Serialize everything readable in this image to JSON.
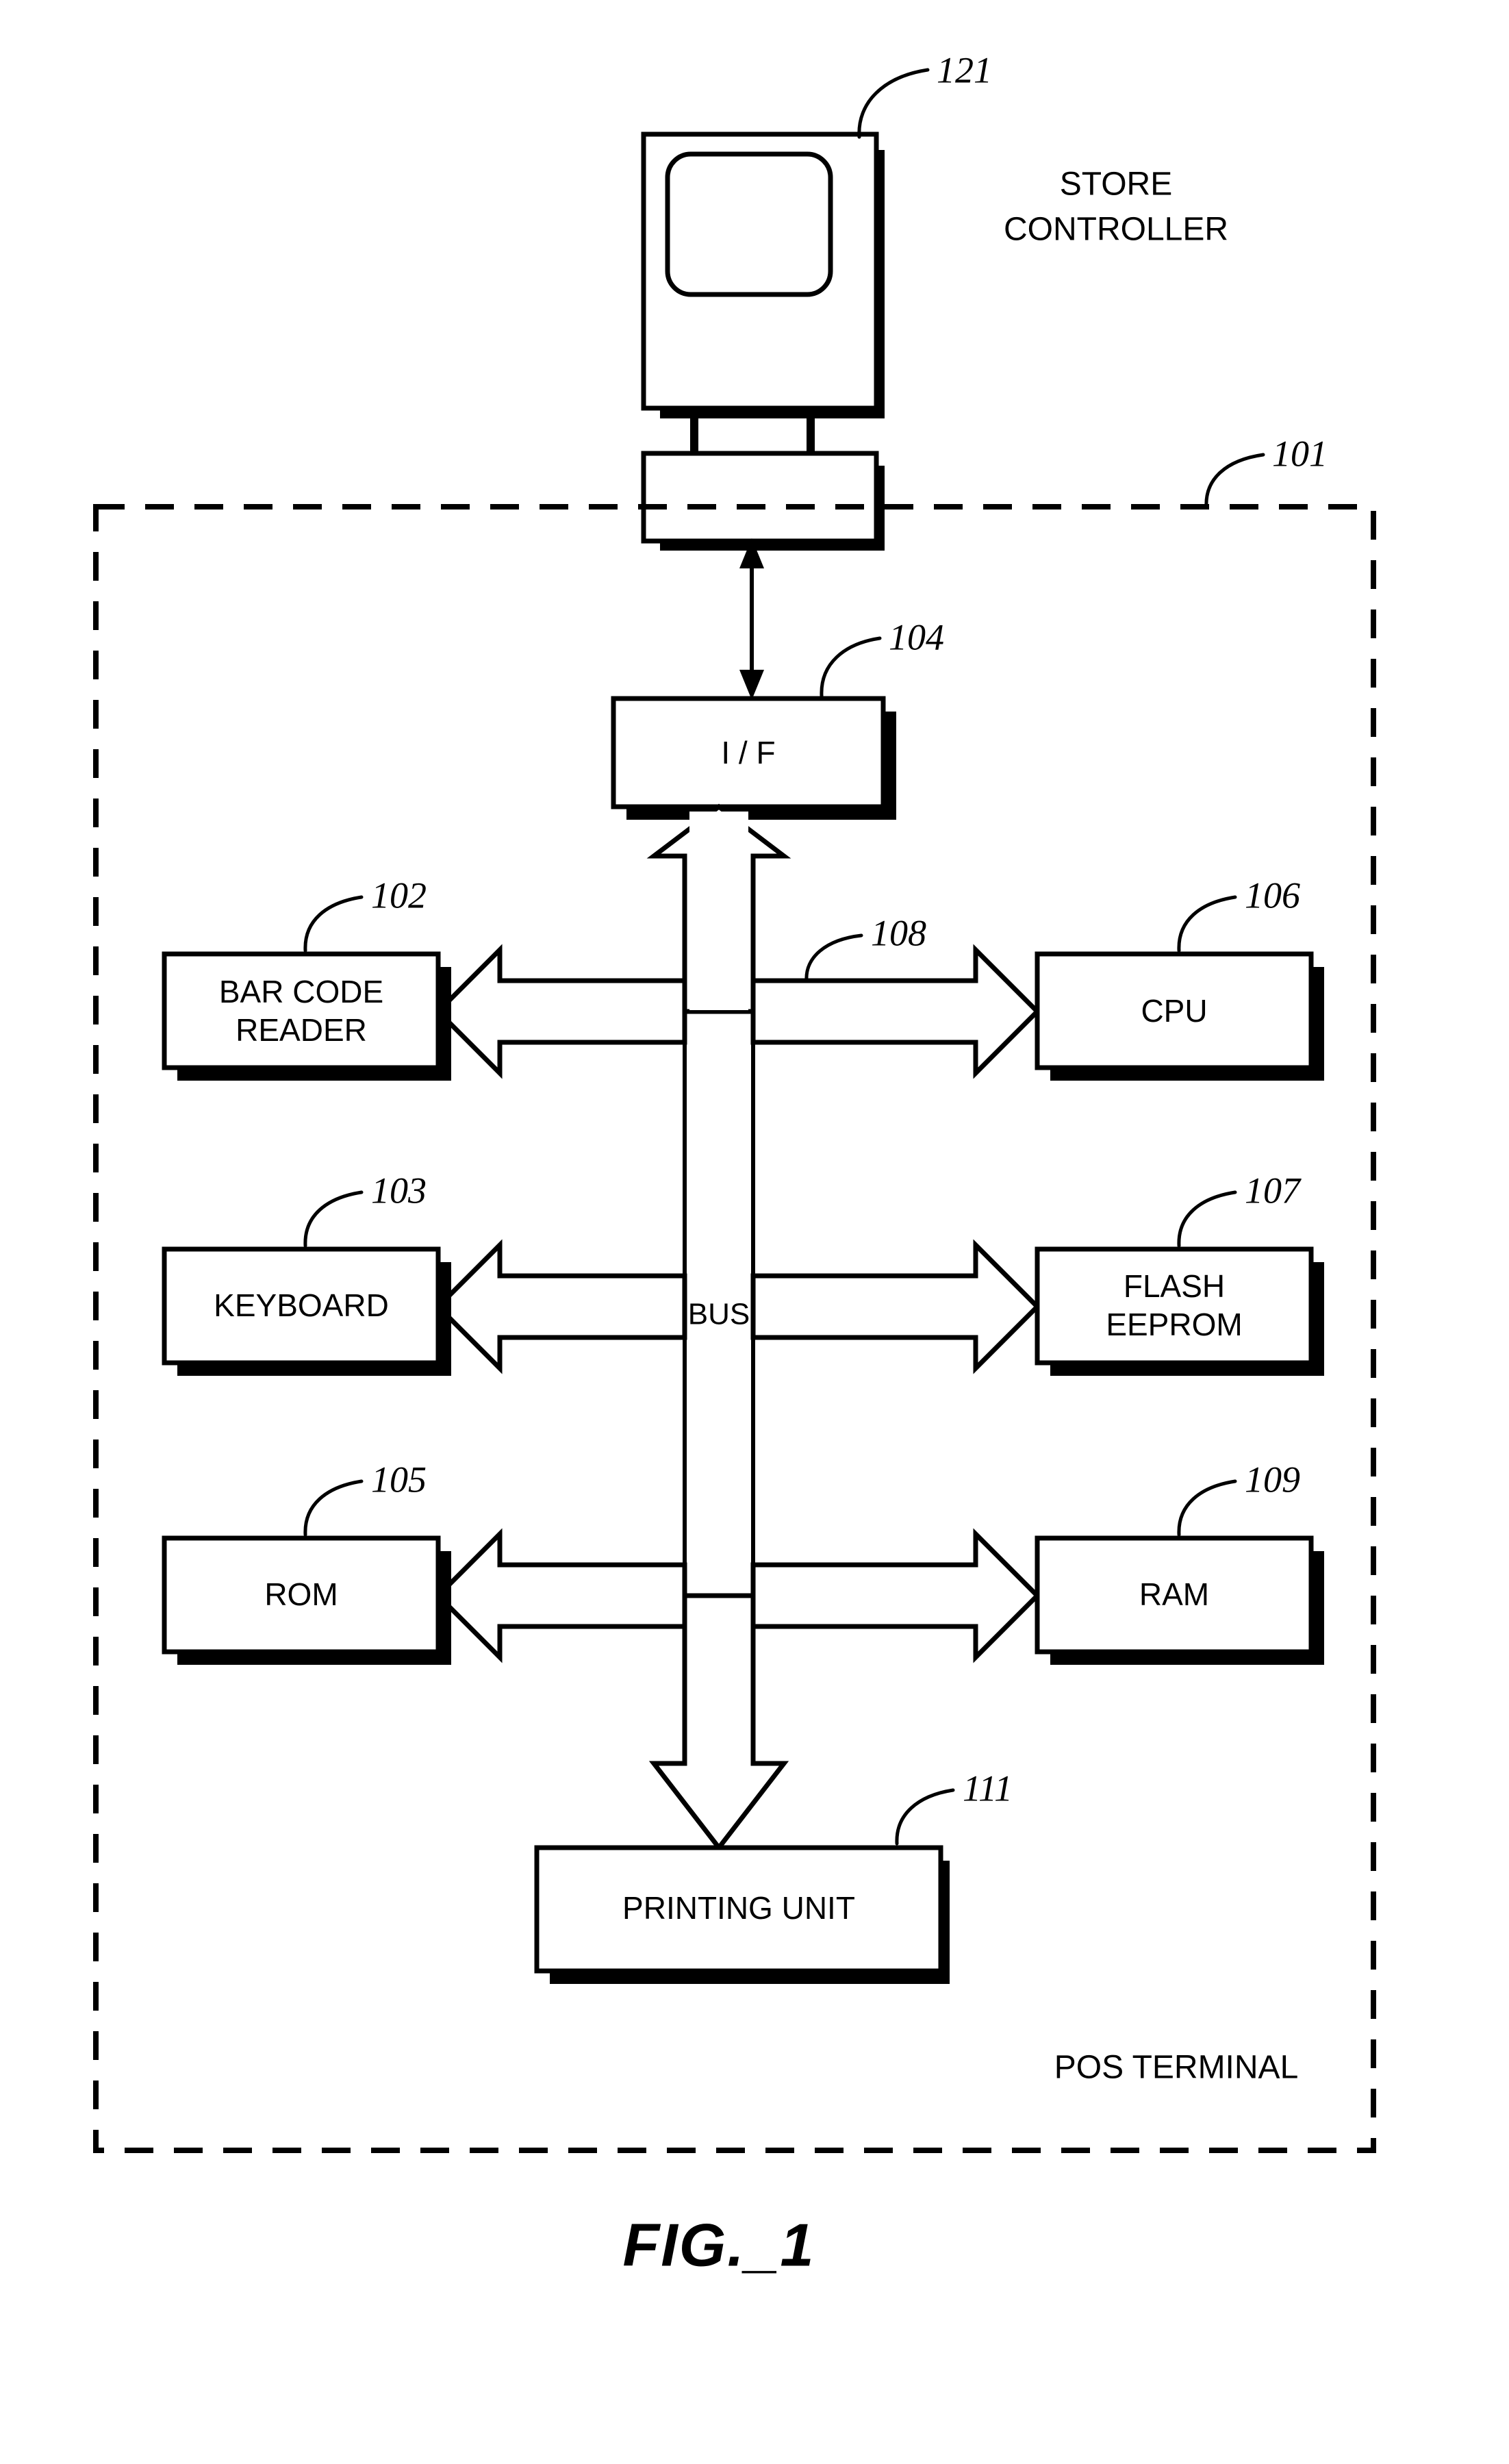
{
  "figure": {
    "caption": "FIG._1",
    "title_block": "STORE CONTROLLER",
    "enclosure_label": "POS TERMINAL",
    "bus_label": "BUS",
    "enclosure_ref": "101",
    "line_color": "#000000",
    "background_color": "#ffffff"
  },
  "external": {
    "store_controller": {
      "label": "STORE CONTROLLER",
      "ref": "121",
      "icon": "computer-monitor-icon"
    }
  },
  "blocks": [
    {
      "id": "if",
      "label": "I / F",
      "ref": "104"
    },
    {
      "id": "bar_code",
      "label": "BAR CODE READER",
      "label_line1": "BAR CODE",
      "label_line2": "READER",
      "ref": "102"
    },
    {
      "id": "keyboard",
      "label": "KEYBOARD",
      "ref": "103"
    },
    {
      "id": "rom",
      "label": "ROM",
      "ref": "105"
    },
    {
      "id": "cpu",
      "label": "CPU",
      "ref": "106"
    },
    {
      "id": "flash_eeprom",
      "label": "FLASH EEPROM",
      "label_line1": "FLASH",
      "label_line2": "EEPROM",
      "ref": "107"
    },
    {
      "id": "ram",
      "label": "RAM",
      "ref": "109"
    },
    {
      "id": "printing_unit",
      "label": "PRINTING UNIT",
      "ref": "111"
    }
  ],
  "bus": {
    "label": "BUS",
    "ref": "108"
  },
  "connections": [
    {
      "from": "store_controller",
      "to": "if",
      "style": "thin-double-arrow"
    },
    {
      "from": "bus",
      "to": "if",
      "style": "hollow-arrow"
    },
    {
      "from": "bus",
      "to": "bar_code",
      "style": "hollow-arrow"
    },
    {
      "from": "bus",
      "to": "keyboard",
      "style": "hollow-arrow"
    },
    {
      "from": "bus",
      "to": "rom",
      "style": "hollow-arrow"
    },
    {
      "from": "bus",
      "to": "cpu",
      "style": "hollow-arrow"
    },
    {
      "from": "bus",
      "to": "flash_eeprom",
      "style": "hollow-arrow"
    },
    {
      "from": "bus",
      "to": "ram",
      "style": "hollow-arrow"
    },
    {
      "from": "bus",
      "to": "printing_unit",
      "style": "hollow-arrow"
    }
  ]
}
